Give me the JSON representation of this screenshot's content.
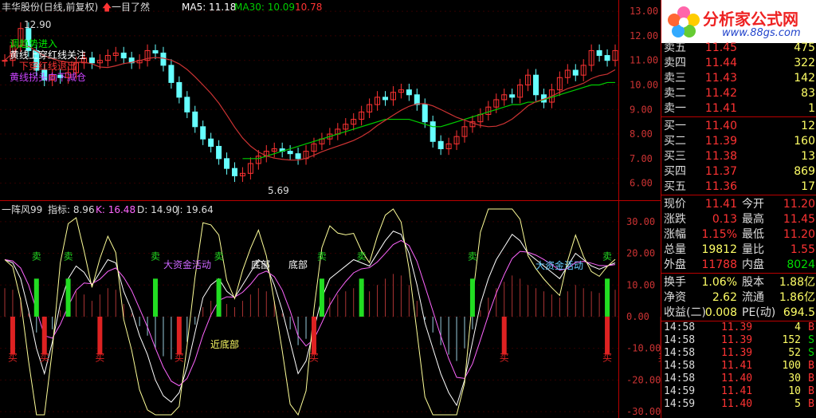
{
  "header": {
    "title": "丰华股份(日线,前复权)",
    "method": "一目了然",
    "ma5_label": "MA5: 11.18",
    "ma30_label": "MA30: 10.09",
    "ma_extra": "10.78",
    "colors": {
      "ma5": "#ffffff",
      "ma30": "#00cc00",
      "extra": "#ff3333"
    }
  },
  "main_legend": {
    "line1": "调趋势进入",
    "line2": "黄线上穿红线关注",
    "line3": "下穿红线退出",
    "line4": "黄线拐头向下减仓"
  },
  "annotations": {
    "high": "12.90",
    "low": "5.69"
  },
  "indicator": {
    "name": "一阵风99",
    "idx_label": "指标: 8.96",
    "k_label": "K: 16.48",
    "d_label": "D: 14.90",
    "j_label": "J: 19.64",
    "sell": "卖",
    "buy": "买",
    "big_fund": "大资金活动",
    "bottom_label": "底部",
    "big_bottom": "近底部"
  },
  "chart_data": {
    "type": "line",
    "price_axis": {
      "ticks": [
        "13.00",
        "12.00",
        "11.00",
        "10.00",
        "9.00",
        "8.00",
        "7.00",
        "6.00"
      ],
      "range": [
        5.5,
        13.2
      ]
    },
    "indicator_axis": {
      "ticks": [
        "30.00",
        "20.00",
        "10.00",
        "0.00",
        "-10.00",
        "-20.00",
        "-30.00"
      ],
      "range": [
        -31,
        34
      ]
    },
    "close_series": [
      11.0,
      11.6,
      12.3,
      11.4,
      10.6,
      10.2,
      10.4,
      10.3,
      10.5,
      10.9,
      11.1,
      10.9,
      11.0,
      11.2,
      11.3,
      11.1,
      10.9,
      11.0,
      11.4,
      11.3,
      10.8,
      10.1,
      9.5,
      8.9,
      8.3,
      7.8,
      7.5,
      7.0,
      6.6,
      6.3,
      6.4,
      6.8,
      7.1,
      7.3,
      7.4,
      7.3,
      7.2,
      7.0,
      7.3,
      7.6,
      7.8,
      8.0,
      8.2,
      8.4,
      8.6,
      8.9,
      9.2,
      9.5,
      9.4,
      9.7,
      9.8,
      9.6,
      9.2,
      8.5,
      7.7,
      7.4,
      7.6,
      7.9,
      8.3,
      8.5,
      8.8,
      9.1,
      9.4,
      9.6,
      9.5,
      10.0,
      10.4,
      9.6,
      9.3,
      9.8,
      10.3,
      10.6,
      10.4,
      10.8,
      11.4,
      11.2,
      11.0,
      11.4
    ],
    "ma30_series": [
      null,
      null,
      null,
      null,
      null,
      null,
      null,
      null,
      null,
      null,
      null,
      null,
      null,
      null,
      null,
      null,
      null,
      null,
      null,
      null,
      null,
      null,
      null,
      null,
      null,
      null,
      null,
      null,
      null,
      null,
      7.0,
      7.0,
      7.0,
      7.1,
      7.2,
      7.3,
      7.4,
      7.5,
      7.6,
      7.7,
      7.8,
      7.9,
      8.0,
      8.1,
      8.2,
      8.3,
      8.4,
      8.5,
      8.6,
      8.6,
      8.6,
      8.6,
      8.5,
      8.4,
      8.3,
      8.3,
      8.4,
      8.5,
      8.6,
      8.7,
      8.8,
      8.9,
      9.0,
      9.1,
      9.2,
      9.2,
      9.3,
      9.3,
      9.4,
      9.5,
      9.6,
      9.7,
      9.8,
      9.9,
      10.0,
      10.0,
      10.1,
      10.1
    ],
    "k_series": [
      18,
      17,
      12,
      2,
      -10,
      -18,
      -8,
      4,
      12,
      16,
      14,
      10,
      14,
      18,
      17,
      8,
      2,
      -6,
      -12,
      -20,
      -25,
      -27,
      -24,
      -16,
      -5,
      6,
      10,
      12,
      8,
      6,
      10,
      14,
      18,
      16,
      10,
      2,
      -8,
      -18,
      -14,
      -4,
      6,
      12,
      14,
      16,
      18,
      17,
      16,
      20,
      24,
      27,
      26,
      20,
      10,
      -2,
      -10,
      -18,
      -24,
      -28,
      -20,
      -8,
      4,
      12,
      18,
      22,
      26,
      24,
      20,
      18,
      16,
      14,
      12,
      16,
      20,
      18,
      16,
      15,
      16,
      17
    ],
    "sell_marks": [
      4,
      8,
      19,
      27,
      40,
      45,
      59,
      76,
      85
    ],
    "buy_marks": [
      1,
      5,
      12,
      22,
      39,
      63,
      76,
      83
    ]
  },
  "quote": {
    "ask": [
      {
        "label": "卖五",
        "price": "11.45",
        "vol": "475"
      },
      {
        "label": "卖四",
        "price": "11.44",
        "vol": "322"
      },
      {
        "label": "卖三",
        "price": "11.43",
        "vol": "142"
      },
      {
        "label": "卖二",
        "price": "11.42",
        "vol": "83"
      },
      {
        "label": "卖一",
        "price": "11.41",
        "vol": "1"
      }
    ],
    "bid": [
      {
        "label": "买一",
        "price": "11.40",
        "vol": "12"
      },
      {
        "label": "买二",
        "price": "11.39",
        "vol": "160"
      },
      {
        "label": "买三",
        "price": "11.38",
        "vol": "13"
      },
      {
        "label": "买四",
        "price": "11.37",
        "vol": "869"
      },
      {
        "label": "买五",
        "price": "11.36",
        "vol": "17"
      }
    ],
    "stats": [
      {
        "l1": "现价",
        "v1": "11.41",
        "l2": "今开",
        "v2": "11.20",
        "c1": "#ff3333",
        "c2": "#ff3333"
      },
      {
        "l1": "涨跌",
        "v1": "0.13",
        "l2": "最高",
        "v2": "11.45",
        "c1": "#ff3333",
        "c2": "#ff3333"
      },
      {
        "l1": "涨幅",
        "v1": "1.15%",
        "l2": "最低",
        "v2": "11.20",
        "c1": "#ff3333",
        "c2": "#ff3333"
      },
      {
        "l1": "总量",
        "v1": "19812",
        "l2": "量比",
        "v2": "1.55",
        "c1": "#ffff66",
        "c2": "#ff3333"
      },
      {
        "l1": "外盘",
        "v1": "11788",
        "l2": "内盘",
        "v2": "8024",
        "c1": "#ff3333",
        "c2": "#00dd00"
      }
    ],
    "stats2": [
      {
        "l1": "换手",
        "v1": "1.06%",
        "l2": "股本",
        "v2": "1.88亿",
        "c1": "#ffff66",
        "c2": "#ffff66"
      },
      {
        "l1": "净资",
        "v1": "2.62",
        "l2": "流通",
        "v2": "1.86亿",
        "c1": "#ffff66",
        "c2": "#ffff66"
      },
      {
        "l1": "收益(二)",
        "v1": "0.008",
        "l2": "PE(动)",
        "v2": "694.5",
        "c1": "#ffff66",
        "c2": "#ffff66"
      }
    ],
    "ticks": [
      {
        "time": "14:58",
        "price": "11.39",
        "vol": "4",
        "dir": "B"
      },
      {
        "time": "14:58",
        "price": "11.39",
        "vol": "152",
        "dir": "S"
      },
      {
        "time": "14:58",
        "price": "11.39",
        "vol": "52",
        "dir": "S"
      },
      {
        "time": "14:58",
        "price": "11.41",
        "vol": "100",
        "dir": "B"
      },
      {
        "time": "14:58",
        "price": "11.40",
        "vol": "30",
        "dir": "B"
      },
      {
        "time": "14:59",
        "price": "11.41",
        "vol": "10",
        "dir": "B"
      },
      {
        "time": "14:59",
        "price": "11.40",
        "vol": "5",
        "dir": "B"
      }
    ]
  },
  "logo": {
    "name": "分析家公式网",
    "url": "www.88gs.com"
  }
}
